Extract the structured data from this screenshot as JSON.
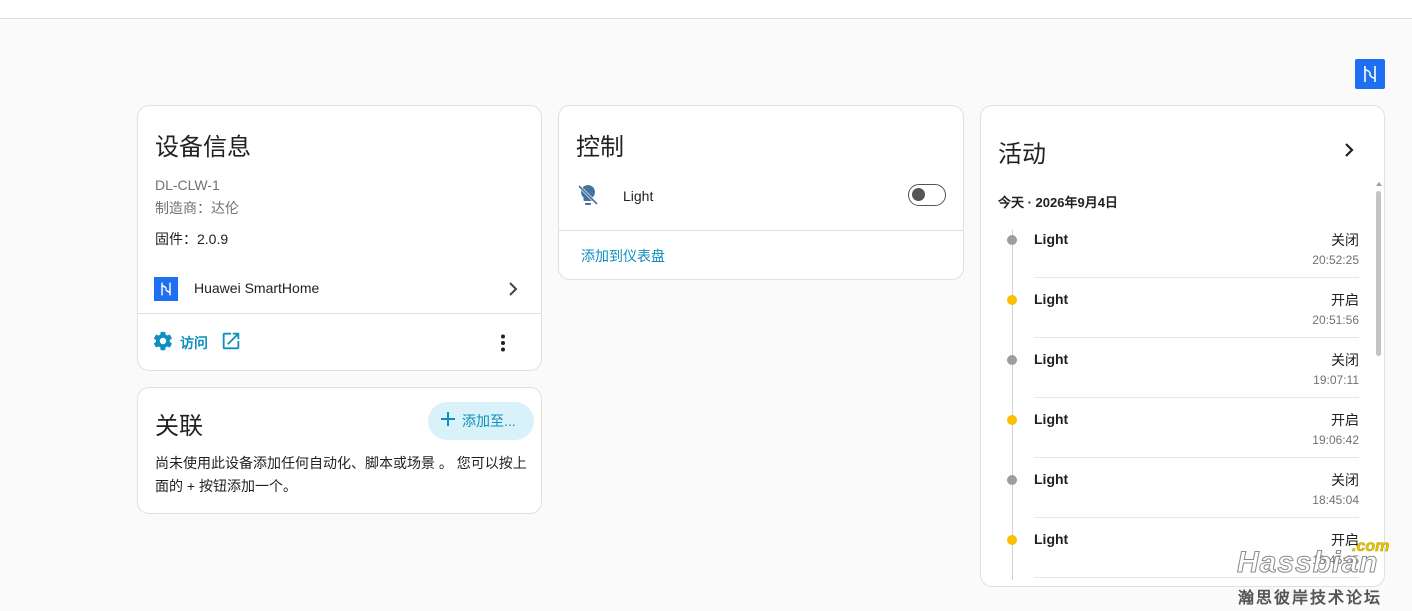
{
  "device_info": {
    "title": "设备信息",
    "model": "DL-CLW-1",
    "manufacturer": "制造商：达伦",
    "firmware": "固件：2.0.9",
    "integration_name": "Huawei SmartHome",
    "visit_label": "访问"
  },
  "related": {
    "title": "关联",
    "add_button_label": "添加至...",
    "empty_text": "尚未使用此设备添加任何自动化、脚本或场景 。 您可以按上面的 + 按钮添加一个。"
  },
  "controls": {
    "title": "控制",
    "entity_name": "Light",
    "toggle_on": false,
    "add_to_dashboard_label": "添加到仪表盘"
  },
  "activity": {
    "title": "活动",
    "day_heading": "今天 · 2026年9月4日",
    "entries": [
      {
        "name": "Light",
        "state": "关闭",
        "time": "20:52:25",
        "dot_color": "#9e9e9e"
      },
      {
        "name": "Light",
        "state": "开启",
        "time": "20:51:56",
        "dot_color": "#fdbf00"
      },
      {
        "name": "Light",
        "state": "关闭",
        "time": "19:07:11",
        "dot_color": "#9e9e9e"
      },
      {
        "name": "Light",
        "state": "开启",
        "time": "19:06:42",
        "dot_color": "#fdbf00"
      },
      {
        "name": "Light",
        "state": "关闭",
        "time": "18:45:04",
        "dot_color": "#9e9e9e"
      },
      {
        "name": "Light",
        "state": "开启",
        "time": "18:45:05",
        "dot_color": "#fdbf00"
      }
    ]
  },
  "colors": {
    "accent": "#0d8fbf",
    "brand_blue": "#1e6ff2",
    "on_dot": "#fdbf00",
    "off_dot": "#9e9e9e"
  },
  "icons": {
    "brand_badge": "huawei-logo-icon",
    "integration": "huawei-logo-icon",
    "entity": "lightbulb-off-icon",
    "visit_gear": "gear-icon",
    "visit_external": "open-in-new-icon",
    "overflow": "kebab-icon"
  },
  "watermark": {
    "main": "Hassbian",
    "com": ".com",
    "sub": "瀚思彼岸技术论坛"
  }
}
